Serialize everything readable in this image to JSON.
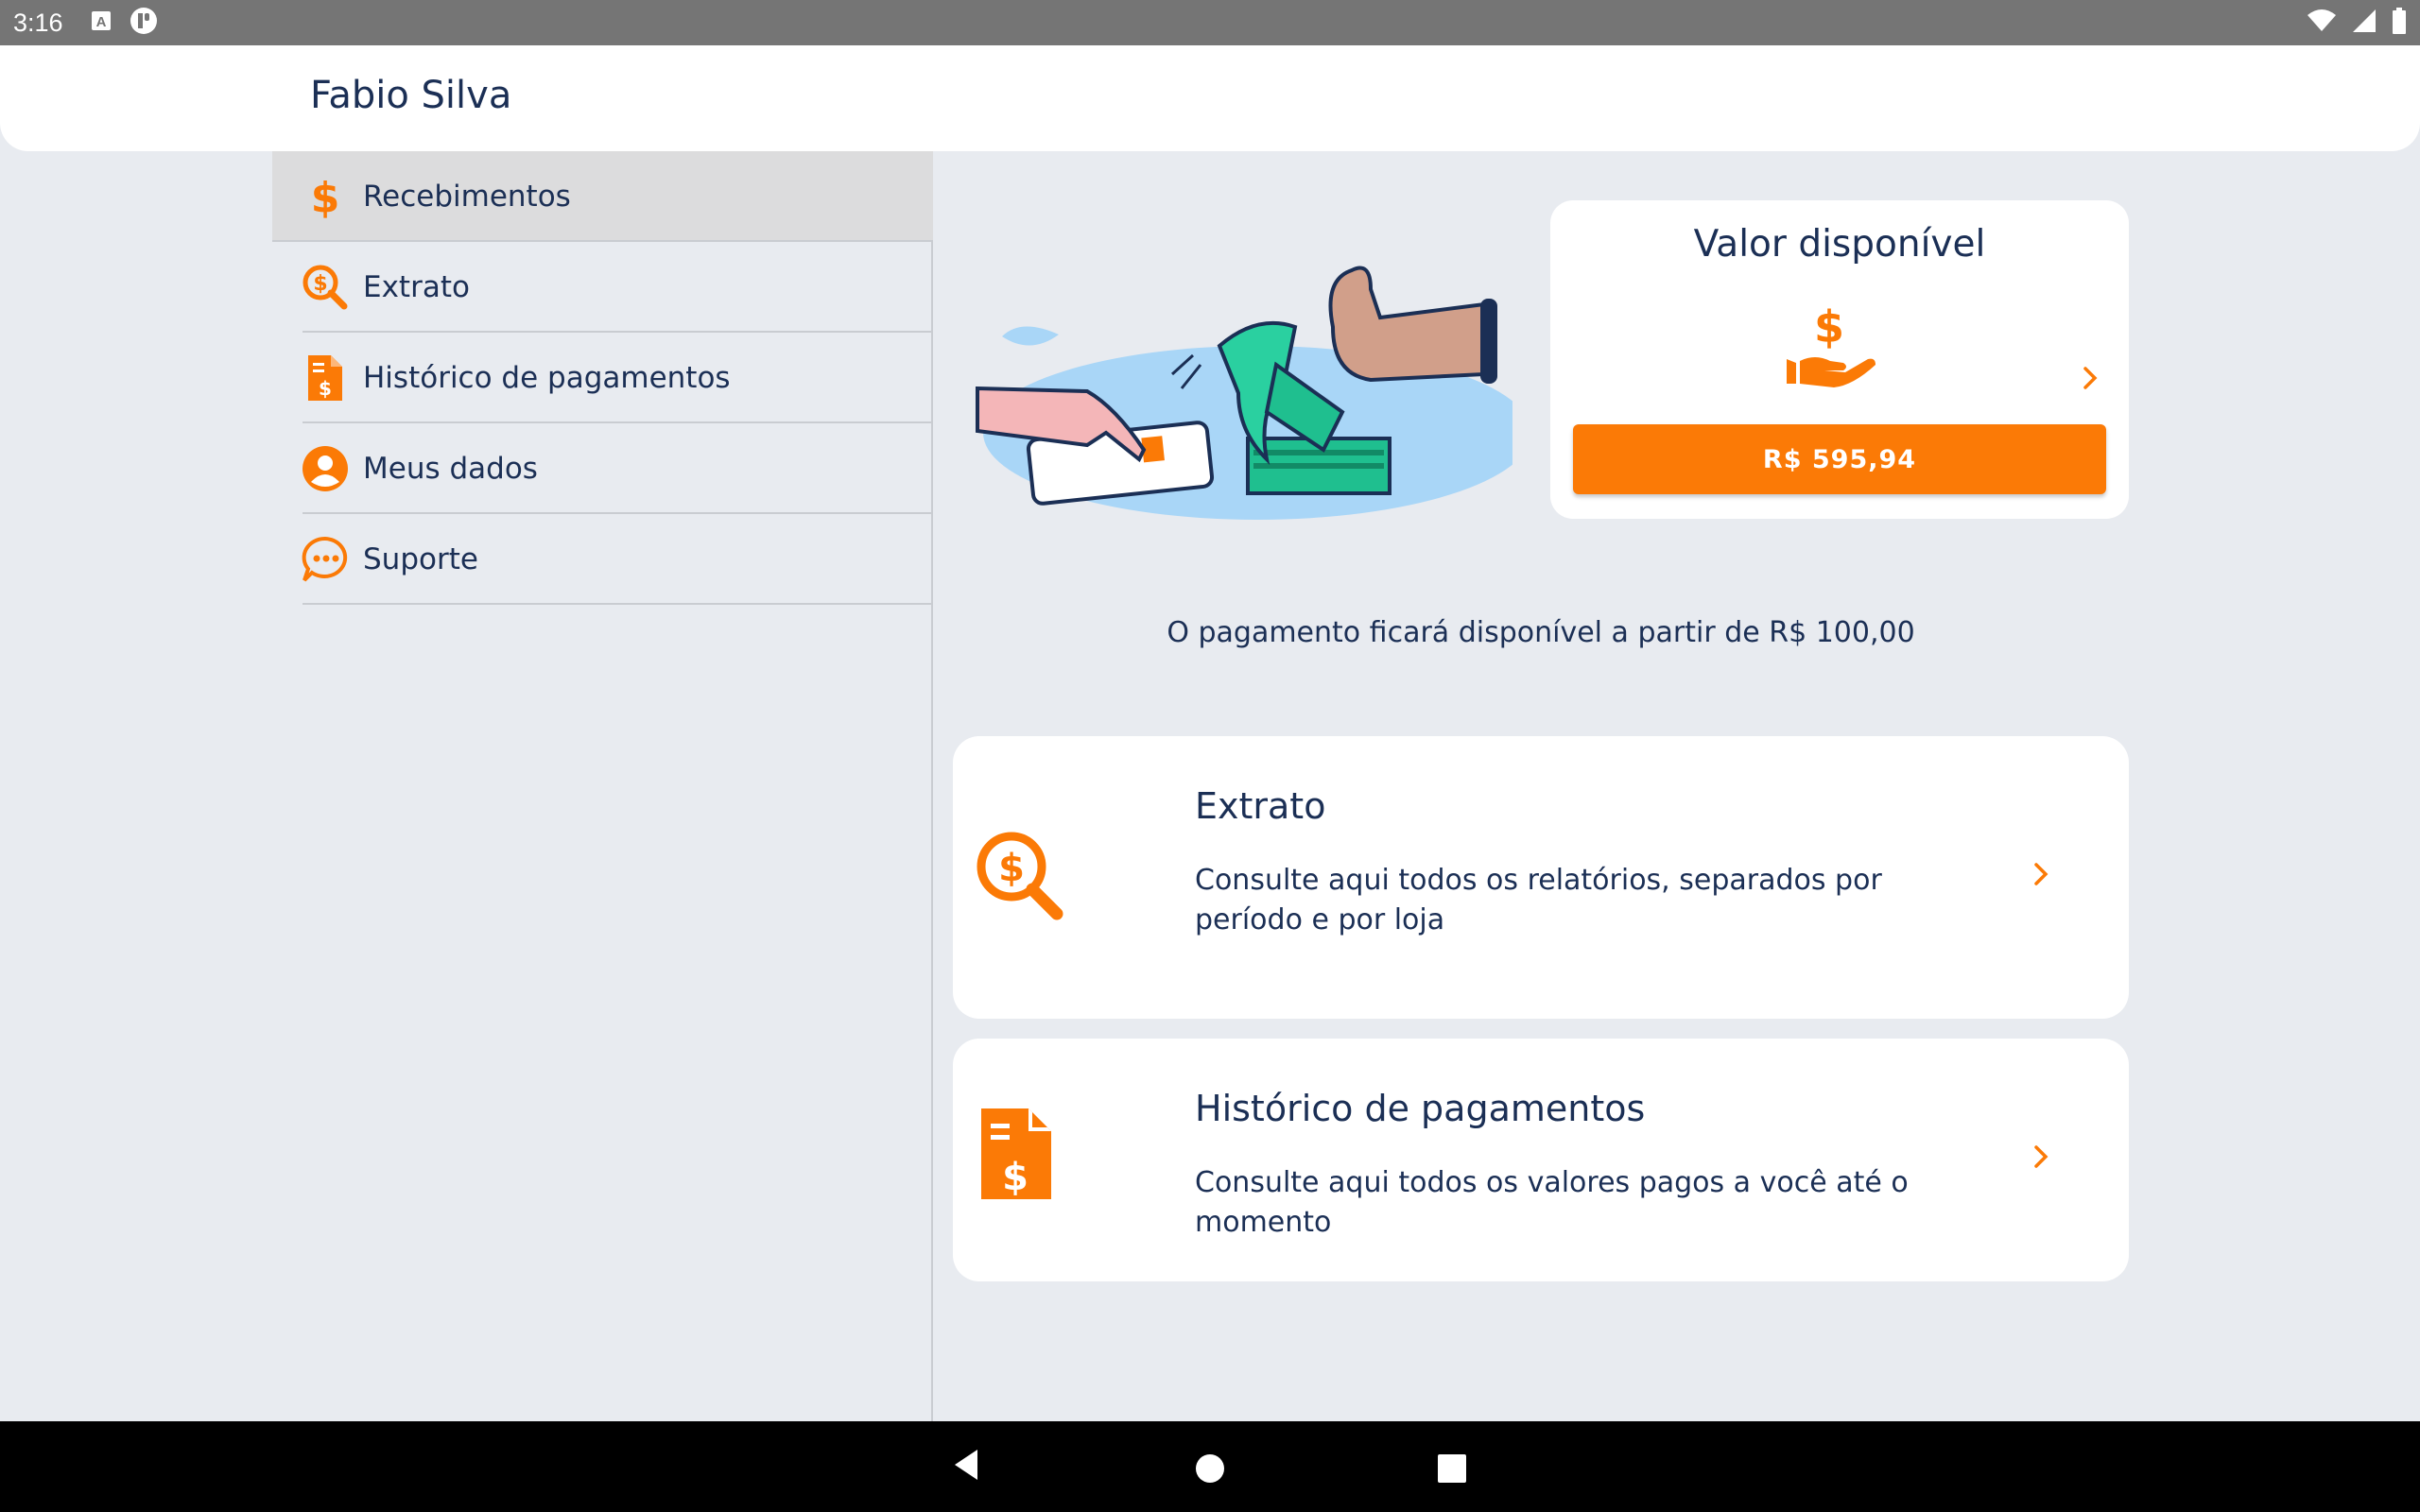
{
  "status_bar": {
    "time": "3:16",
    "icons": [
      "notification-a-icon",
      "notification-app-icon",
      "wifi-icon",
      "cell-signal-icon",
      "battery-icon"
    ]
  },
  "header": {
    "user_name": "Fabio Silva"
  },
  "sidebar": {
    "items": [
      {
        "label": "Recebimentos",
        "icon": "dollar-icon",
        "active": true
      },
      {
        "label": "Extrato",
        "icon": "search-dollar-icon",
        "active": false
      },
      {
        "label": "Histórico de pagamentos",
        "icon": "invoice-dollar-icon",
        "active": false
      },
      {
        "label": "Meus dados",
        "icon": "user-icon",
        "active": false
      },
      {
        "label": "Suporte",
        "icon": "chat-icon",
        "active": false
      }
    ]
  },
  "available_card": {
    "title": "Valor disponível",
    "amount": "R$ 595,94",
    "icon": "hand-dollar-icon"
  },
  "notice": "O pagamento ficará disponível a partir de R$ 100,00",
  "cards": [
    {
      "title": "Extrato",
      "description": "Consulte aqui todos os relatórios, separados por período e por loja",
      "icon": "search-dollar-icon"
    },
    {
      "title": "Histórico de pagamentos",
      "description": "Consulte aqui todos os valores pagos a você até o momento",
      "icon": "invoice-dollar-icon"
    }
  ],
  "colors": {
    "accent": "#fb7a06",
    "text": "#1b2f55",
    "background": "#e8ebf0",
    "sidebar_active": "#dcdcdd"
  }
}
